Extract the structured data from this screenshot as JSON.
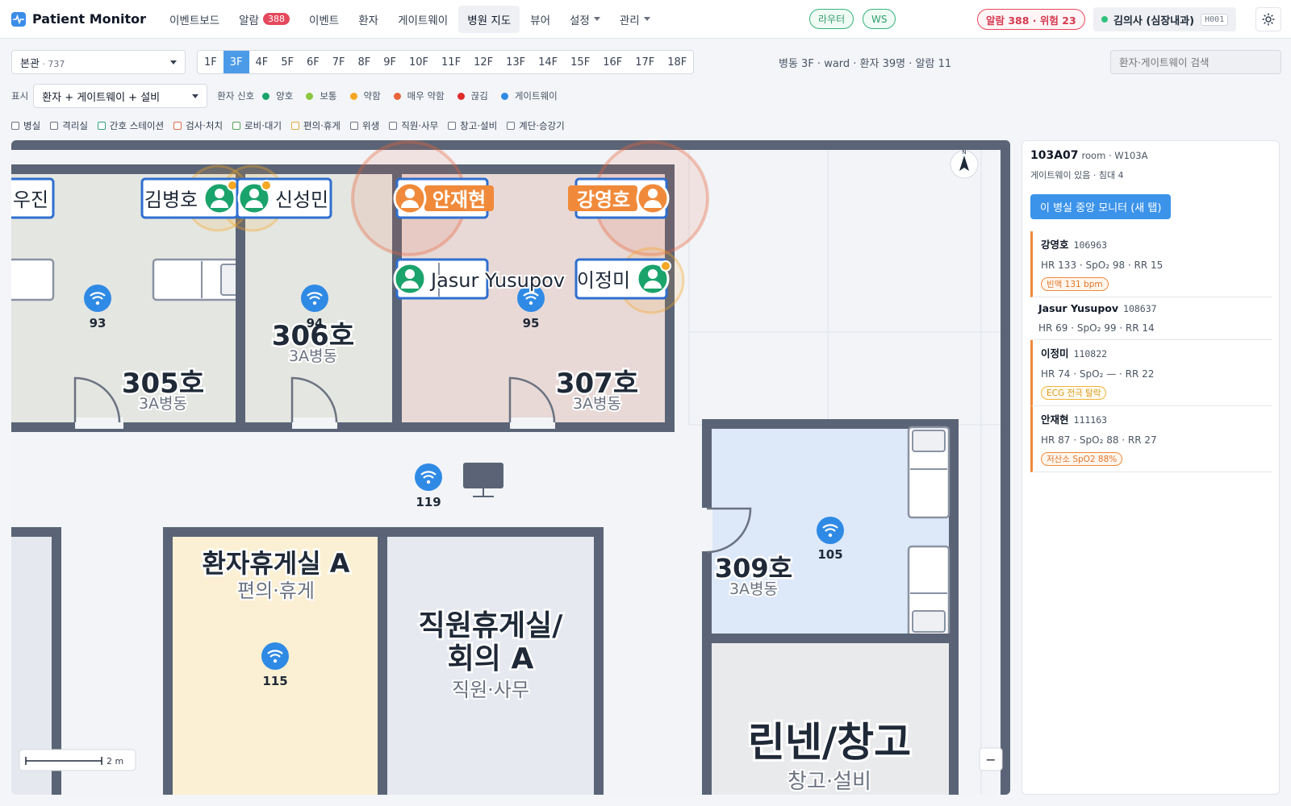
{
  "app": {
    "title": "Patient Monitor"
  },
  "nav": [
    {
      "label": "이벤트보드"
    },
    {
      "label": "알람",
      "badge": "388"
    },
    {
      "label": "이벤트"
    },
    {
      "label": "환자"
    },
    {
      "label": "게이트웨이"
    },
    {
      "label": "병원 지도",
      "active": true
    },
    {
      "label": "뷰어"
    },
    {
      "label": "설정",
      "dropdown": true
    },
    {
      "label": "관리",
      "dropdown": true
    }
  ],
  "status": {
    "router": "라우터",
    "ws": "WS",
    "alert_summary": "알람 388 · 위험 23"
  },
  "user": {
    "name": "김의사 (심장내과)",
    "code": "H001"
  },
  "building_select": {
    "label": "본관",
    "count": "737"
  },
  "floors": [
    "1F",
    "3F",
    "4F",
    "5F",
    "6F",
    "7F",
    "8F",
    "9F",
    "10F",
    "11F",
    "12F",
    "13F",
    "14F",
    "15F",
    "16F",
    "17F",
    "18F"
  ],
  "active_floor": "3F",
  "ward_info": "병동 3F · ward · 환자 39명 · 알람 11",
  "search": {
    "placeholder": "환자·게이트웨이 검색"
  },
  "display": {
    "label": "표시",
    "value": "환자 + 게이트웨이 + 설비"
  },
  "legend": {
    "title": "환자 신호",
    "items": [
      {
        "label": "양호",
        "color": "#1aa36b"
      },
      {
        "label": "보통",
        "color": "#8cc63f"
      },
      {
        "label": "약함",
        "color": "#f5a623"
      },
      {
        "label": "매우 약함",
        "color": "#e8643c"
      },
      {
        "label": "끊김",
        "color": "#e02b2b"
      },
      {
        "label": "게이트웨이",
        "color": "#2f8ae5"
      }
    ]
  },
  "filters": [
    "병실",
    "격리실",
    "간호 스테이션",
    "검사·처치",
    "로비·대기",
    "편의·휴게",
    "위생",
    "직원·사무",
    "창고·설비",
    "계단·승강기"
  ],
  "filter_colors": [
    "#6b7280",
    "#6b7280",
    "#34a37a",
    "#e06a4a",
    "#5aa05a",
    "#e0a63a",
    "#6b7280",
    "#6b7280",
    "#6b7280",
    "#6b7280"
  ],
  "map": {
    "rooms": {
      "r305": {
        "name": "305호",
        "sub": "3A병동"
      },
      "r306": {
        "name": "306호",
        "sub": "3A병동"
      },
      "r307": {
        "name": "307호",
        "sub": "3A병동"
      },
      "r309": {
        "name": "309호",
        "sub": "3A병동"
      },
      "lounge": {
        "name": "환자휴게실 A",
        "sub": "편의·휴게"
      },
      "staff": {
        "name1": "직원휴게실/",
        "name2": "회의 A",
        "sub": "직원·사무"
      },
      "linen": {
        "name": "린넨/창고",
        "sub": "창고·설비"
      }
    },
    "gateways": [
      "93",
      "94",
      "95",
      "119",
      "105",
      "115"
    ],
    "patients": {
      "woojin": "우진",
      "kimbh": "김병호",
      "shinsm": "신성민",
      "ahnjh": "안재현",
      "kangyh": "강영호",
      "jasur": "Jasur Yusupov",
      "leejm": "이정미"
    },
    "scale": "2 m",
    "compass": "N",
    "zoom_out": "−"
  },
  "detail": {
    "room_id": "103A07",
    "room_meta": "room · W103A",
    "sub": "게이트웨이 있음 · 침대 4",
    "button": "이 병실 중앙 모니터 (새 탭)",
    "patients": [
      {
        "name": "강영호",
        "id": "106963",
        "vitals": "HR 133 · SpO₂ 98 · RR 15",
        "tag": "빈맥 131 bpm",
        "tag_style": "orange",
        "flag": true
      },
      {
        "name": "Jasur Yusupov",
        "id": "108637",
        "vitals": "HR 69 · SpO₂ 99 · RR 14",
        "tag": "",
        "flag": false
      },
      {
        "name": "이정미",
        "id": "110822",
        "vitals": "HR 74 · SpO₂ — · RR 22",
        "tag": "ECG 전극 탈락",
        "tag_style": "yellow",
        "flag": true
      },
      {
        "name": "안재현",
        "id": "111163",
        "vitals": "HR 87 · SpO₂ 88 · RR 27",
        "tag": "저산소 SpO2 88%",
        "tag_style": "orange",
        "flag": true
      }
    ]
  }
}
